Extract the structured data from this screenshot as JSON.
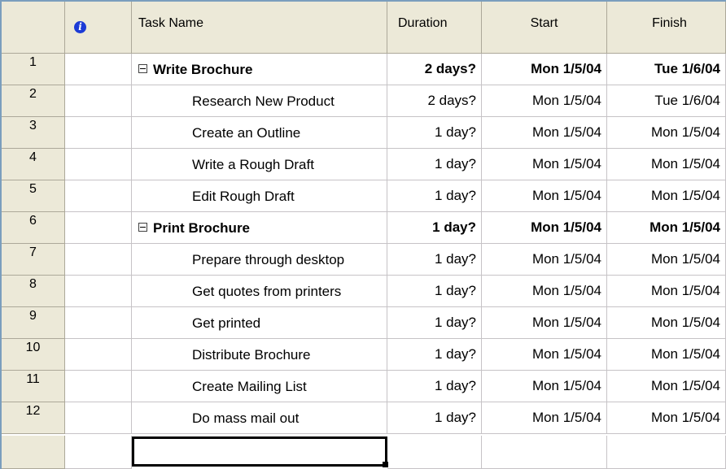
{
  "headers": {
    "info_icon": "info-icon",
    "task_name": "Task Name",
    "duration": "Duration",
    "start": "Start",
    "finish": "Finish"
  },
  "rows": [
    {
      "id": "1",
      "name": "Write Brochure",
      "duration": "2 days?",
      "start": "Mon 1/5/04",
      "finish": "Tue 1/6/04",
      "summary": true
    },
    {
      "id": "2",
      "name": "Research New Product",
      "duration": "2 days?",
      "start": "Mon 1/5/04",
      "finish": "Tue 1/6/04",
      "summary": false
    },
    {
      "id": "3",
      "name": "Create an Outline",
      "duration": "1 day?",
      "start": "Mon 1/5/04",
      "finish": "Mon 1/5/04",
      "summary": false
    },
    {
      "id": "4",
      "name": "Write a Rough Draft",
      "duration": "1 day?",
      "start": "Mon 1/5/04",
      "finish": "Mon 1/5/04",
      "summary": false
    },
    {
      "id": "5",
      "name": "Edit Rough Draft",
      "duration": "1 day?",
      "start": "Mon 1/5/04",
      "finish": "Mon 1/5/04",
      "summary": false
    },
    {
      "id": "6",
      "name": "Print Brochure",
      "duration": "1 day?",
      "start": "Mon 1/5/04",
      "finish": "Mon 1/5/04",
      "summary": true
    },
    {
      "id": "7",
      "name": "Prepare through desktop",
      "duration": "1 day?",
      "start": "Mon 1/5/04",
      "finish": "Mon 1/5/04",
      "summary": false
    },
    {
      "id": "8",
      "name": "Get quotes from printers",
      "duration": "1 day?",
      "start": "Mon 1/5/04",
      "finish": "Mon 1/5/04",
      "summary": false
    },
    {
      "id": "9",
      "name": "Get printed",
      "duration": "1 day?",
      "start": "Mon 1/5/04",
      "finish": "Mon 1/5/04",
      "summary": false
    },
    {
      "id": "10",
      "name": "Distribute Brochure",
      "duration": "1 day?",
      "start": "Mon 1/5/04",
      "finish": "Mon 1/5/04",
      "summary": false
    },
    {
      "id": "11",
      "name": "Create Mailing List",
      "duration": "1 day?",
      "start": "Mon 1/5/04",
      "finish": "Mon 1/5/04",
      "summary": false
    },
    {
      "id": "12",
      "name": "Do mass mail out",
      "duration": "1 day?",
      "start": "Mon 1/5/04",
      "finish": "Mon 1/5/04",
      "summary": false
    }
  ],
  "colors": {
    "header_bg": "#ece9d8",
    "grid": "#c6c3c6",
    "info_icon": "#1c3bd6",
    "selection_border": "#000000"
  }
}
